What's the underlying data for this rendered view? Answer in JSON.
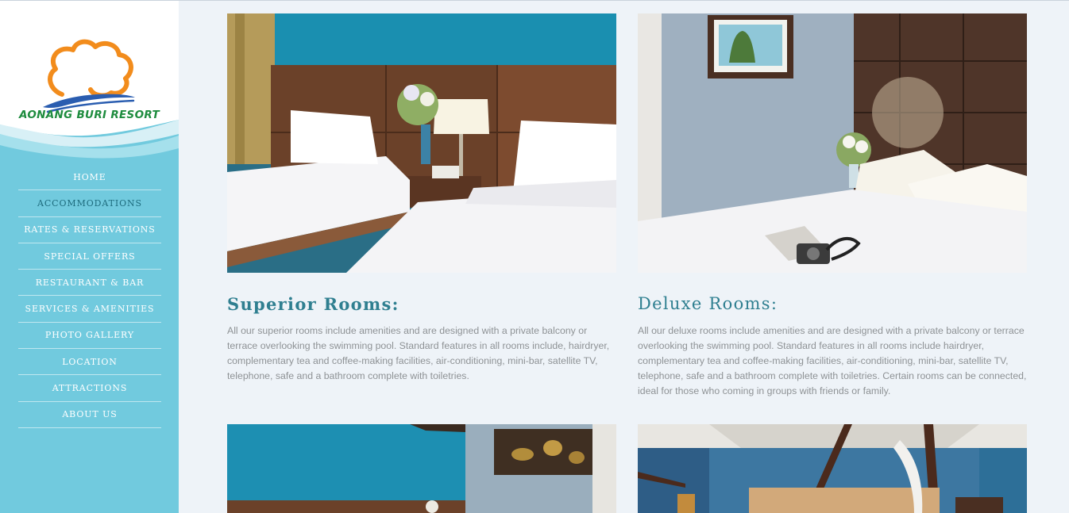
{
  "brand": {
    "logo_text": "AONANG BURI RESORT",
    "colors": {
      "sidebar": "#71cade",
      "logo_orange": "#f28c1c",
      "logo_blue": "#2a5db0",
      "logo_green": "#1e8c3e",
      "heading": "#2f7f90",
      "body_text": "#8e9295",
      "page_bg": "#eef3f8"
    }
  },
  "nav": {
    "items": [
      {
        "label": "HOME"
      },
      {
        "label": "ACCOMMODATIONS"
      },
      {
        "label": "RATES & RESERVATIONS"
      },
      {
        "label": "SPECIAL OFFERS"
      },
      {
        "label": "RESTAURANT & BAR"
      },
      {
        "label": "SERVICES & AMENITIES"
      },
      {
        "label": "PHOTO GALLERY"
      },
      {
        "label": "LOCATION"
      },
      {
        "label": "ATTRACTIONS"
      },
      {
        "label": "ABOUT US"
      }
    ],
    "active_index": 1
  },
  "rooms": [
    {
      "title": "Superior Rooms:",
      "description": "All our superior rooms include amenities and are designed with a private balcony or terrace overlooking the swimming pool. Standard features in all rooms include, hairdryer, complementary tea and coffee-making facilities, air-conditioning, mini-bar, satellite TV, telephone, safe and a bathroom complete with toiletries."
    },
    {
      "title": "Deluxe Rooms:",
      "description": "All our deluxe rooms include amenities and are designed with a private balcony or terrace overlooking the swimming pool. Standard features in all rooms include hairdryer, complementary tea and coffee-making facilities, air-conditioning, mini-bar, satellite TV, telephone, safe and a bathroom complete with toiletries. Certain rooms can be connected, ideal for those who coming in groups with friends or family."
    }
  ]
}
